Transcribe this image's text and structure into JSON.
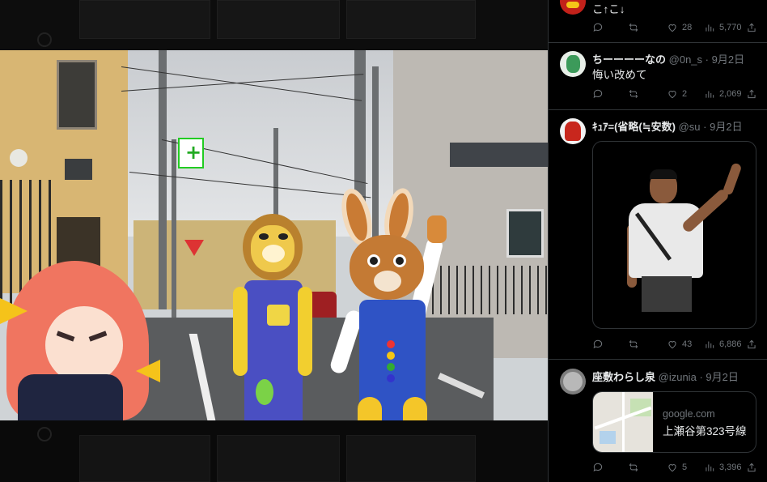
{
  "colors": {
    "background": "#000000",
    "text_primary": "#e7e9ea",
    "text_secondary": "#71767b",
    "border": "#2f3336"
  },
  "viewer": {
    "photo_description_icon": "photo-image",
    "overlay_icon": "anime-sticker"
  },
  "timeline": {
    "tweets": [
      {
        "name": "",
        "handle": "",
        "date": "",
        "text": "こ↑こ↓",
        "replies": "",
        "retweets": "",
        "likes": "28",
        "views": "5,770"
      },
      {
        "name": "ちーーーーなの",
        "handle": "@0n_s",
        "date": "9月2日",
        "text": "悔い改めて",
        "replies": "",
        "retweets": "",
        "likes": "2",
        "views": "2,069"
      },
      {
        "name": "ｷｭｱ=(省略(≒安数)",
        "handle": "@su",
        "date": "9月2日",
        "text": "",
        "replies": "",
        "retweets": "",
        "likes": "43",
        "views": "6,886"
      },
      {
        "name": "座敷わらし泉",
        "handle": "@izunia",
        "date": "9月2日",
        "text": "",
        "card_domain": "google.com",
        "card_title": "上瀬谷第323号線",
        "replies": "",
        "retweets": "",
        "likes": "5",
        "views": "3,396"
      }
    ]
  }
}
